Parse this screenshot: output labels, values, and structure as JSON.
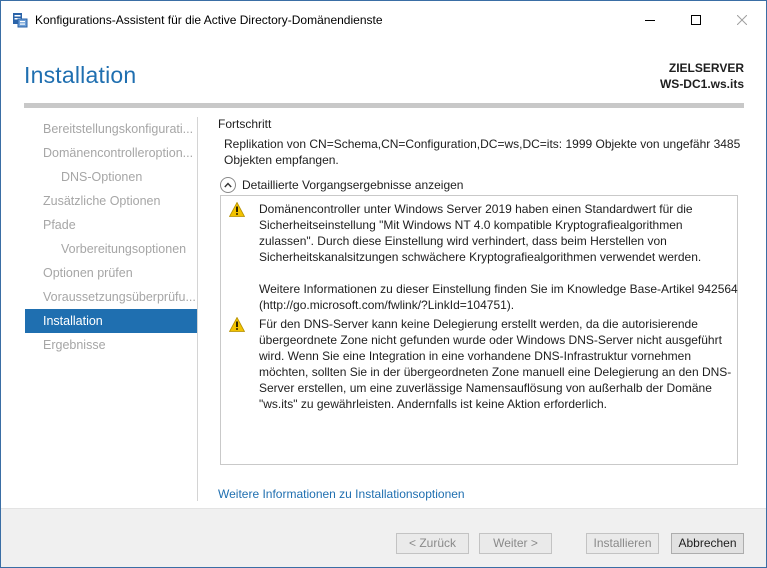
{
  "window": {
    "title": "Konfigurations-Assistent für die Active Directory-Domänendienste",
    "controls": {
      "minimize": "—",
      "maximize": "☐",
      "close": "✕"
    }
  },
  "header": {
    "title": "Installation",
    "target_label": "ZIELSERVER",
    "target_name": "WS-DC1.ws.its"
  },
  "sidebar": {
    "items": [
      {
        "label": "Bereitstellungskonfigurati...",
        "level": 0,
        "active": false
      },
      {
        "label": "Domänencontrolleroption...",
        "level": 0,
        "active": false
      },
      {
        "label": "DNS-Optionen",
        "level": 1,
        "active": false
      },
      {
        "label": "Zusätzliche Optionen",
        "level": 0,
        "active": false
      },
      {
        "label": "Pfade",
        "level": 0,
        "active": false
      },
      {
        "label": "Vorbereitungsoptionen",
        "level": 1,
        "active": false
      },
      {
        "label": "Optionen prüfen",
        "level": 0,
        "active": false
      },
      {
        "label": "Voraussetzungsüberprüfu...",
        "level": 0,
        "active": false
      },
      {
        "label": "Installation",
        "level": 0,
        "active": true
      },
      {
        "label": "Ergebnisse",
        "level": 0,
        "active": false
      }
    ]
  },
  "main": {
    "section_label": "Fortschritt",
    "progress_text": "Replikation von CN=Schema,CN=Configuration,DC=ws,DC=its: 1999 Objekte von ungefähr 3485 Objekten empfangen.",
    "details_toggle": "Detaillierte Vorgangsergebnisse anzeigen",
    "results": {
      "warning1_p1": "Domänencontroller unter Windows Server 2019 haben einen Standardwert für die Sicherheitseinstellung \"Mit Windows NT 4.0 kompatible Kryptografiealgorithmen zulassen\". Durch diese Einstellung wird verhindert, dass beim Herstellen von Sicherheitskanalsitzungen schwächere Kryptografiealgorithmen verwendet werden.",
      "warning1_p2": "Weitere Informationen zu dieser Einstellung finden Sie im Knowledge Base-Artikel 942564 (http://go.microsoft.com/fwlink/?LinkId=104751).",
      "warning2_p1": "Für den DNS-Server kann keine Delegierung erstellt werden, da die autorisierende übergeordnete Zone nicht gefunden wurde oder Windows DNS-Server nicht ausgeführt wird. Wenn Sie eine Integration in eine vorhandene DNS-Infrastruktur vornehmen möchten, sollten Sie in der übergeordneten Zone manuell eine Delegierung an den DNS-Server erstellen, um eine zuverlässige Namensauflösung von außerhalb der Domäne \"ws.its\" zu gewährleisten. Andernfalls ist keine Aktion erforderlich."
    },
    "more_info_link": "Weitere Informationen zu Installationsoptionen"
  },
  "footer": {
    "back": "< Zurück",
    "next": "Weiter >",
    "install": "Installieren",
    "cancel": "Abbrechen"
  },
  "colors": {
    "accent": "#1f6fb0",
    "warning": "#f2c200"
  }
}
